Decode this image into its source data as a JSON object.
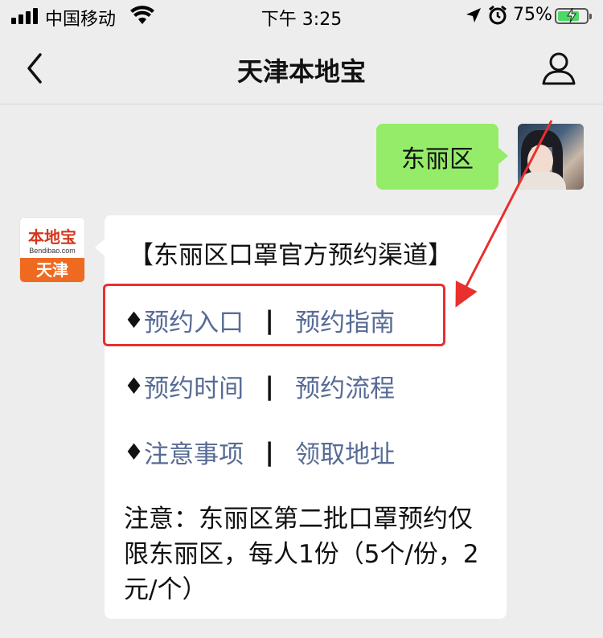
{
  "status_bar": {
    "carrier": "中国移动",
    "time": "下午 3:25",
    "battery_percent": "75%",
    "battery_level": 0.75,
    "icons": [
      "signal-icon",
      "wifi-icon",
      "location-icon",
      "alarm-icon",
      "battery-icon"
    ]
  },
  "nav": {
    "title": "天津本地宝",
    "icons": [
      "back-icon",
      "profile-icon"
    ]
  },
  "chat": {
    "outgoing": {
      "text": "东丽区"
    },
    "brand_avatar": {
      "logo_top": "本地宝",
      "logo_url": "Bendibao.com",
      "logo_bottom": "天津"
    },
    "incoming": {
      "title": "【东丽区口罩官方预约渠道】",
      "rows": [
        {
          "bullet": "♦",
          "left": "预约入口",
          "sep": "|",
          "right": "预约指南"
        },
        {
          "bullet": "♦",
          "left": "预约时间",
          "sep": "|",
          "right": "预约流程"
        },
        {
          "bullet": "♦",
          "left": "注意事项",
          "sep": "|",
          "right": "领取地址"
        }
      ],
      "note": "注意：东丽区第二批口罩预约仅限东丽区，每人1份（5个/份，2元/个）"
    }
  },
  "annotation": {
    "box_color": "#e8302e",
    "arrow_color": "#e8302e"
  },
  "colors": {
    "bubble_out": "#95ec69",
    "link": "#576b95",
    "background": "#ededed"
  }
}
